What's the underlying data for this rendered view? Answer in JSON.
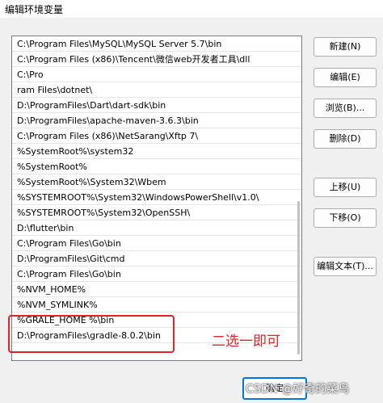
{
  "window": {
    "title": "编辑环境变量"
  },
  "paths": [
    "C:\\Program Files\\MySQL\\MySQL Server 5.7\\bin",
    "C:\\Program Files (x86)\\Tencent\\微信web开发者工具\\dll",
    "C:\\Pro",
    "ram Files\\dotnet\\",
    "D:\\ProgramFiles\\Dart\\dart-sdk\\bin",
    "D:\\ProgramFiles\\apache-maven-3.6.3\\bin",
    "C:\\Program Files (x86)\\NetSarang\\Xftp 7\\",
    "%SystemRoot%\\system32",
    "%SystemRoot%",
    "%SystemRoot%\\System32\\Wbem",
    "%SYSTEMROOT%\\System32\\WindowsPowerShell\\v1.0\\",
    "%SYSTEMROOT%\\System32\\OpenSSH\\",
    "D:\\flutter\\bin",
    "C:\\Program Files\\Go\\bin",
    "D:\\ProgramFiles\\Git\\cmd",
    "C:\\Program Files\\Go\\bin",
    "%NVM_HOME%",
    "%NVM_SYMLINK%",
    "%GRALE_HOME %\\bin",
    "D:\\ProgramFiles\\gradle-8.0.2\\bin"
  ],
  "buttons": {
    "new": "新建(N)",
    "edit": "编辑(E)",
    "browse": "浏览(B)...",
    "delete": "删除(D)",
    "move_up": "上移(U)",
    "move_down": "下移(O)",
    "edit_text": "编辑文本(T)...",
    "ok": "确定"
  },
  "annotation": "二选一即可",
  "watermark": "CSDN @好奇的菜鸟",
  "colors": {
    "annotation": "#e0242a",
    "ok_border": "#0078d7"
  }
}
